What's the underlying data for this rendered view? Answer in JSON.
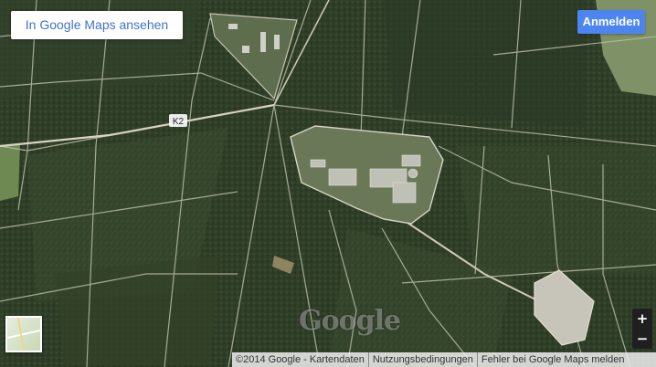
{
  "map": {
    "type": "satellite",
    "road_label": "K2",
    "watermark": "Google"
  },
  "controls": {
    "open_in_maps": "In Google Maps ansehen",
    "sign_in": "Anmelden",
    "zoom_in": "+",
    "zoom_out": "−"
  },
  "attribution": {
    "copyright": "©2014 Google - Kartendaten",
    "terms": "Nutzungsbedingungen",
    "report": "Fehler bei Google Maps melden"
  },
  "colors": {
    "forest": "#2f3e27",
    "field": "#8f9e7b",
    "road": "#c9c5b4",
    "button_blue": "#4d85f0",
    "link_blue": "#3f73c9"
  }
}
